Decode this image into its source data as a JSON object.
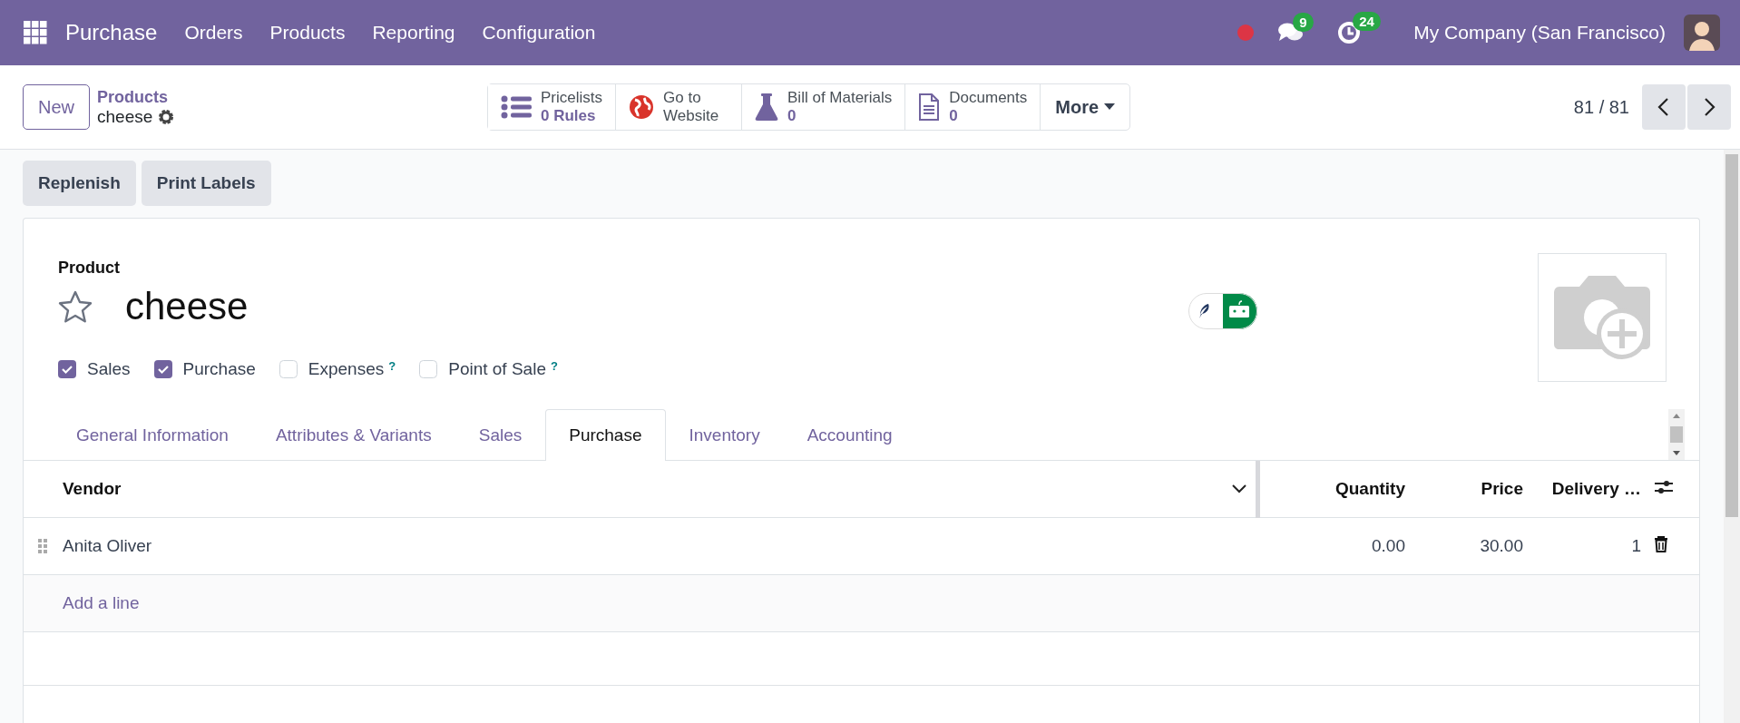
{
  "navbar": {
    "app": "Purchase",
    "menus": [
      "Orders",
      "Products",
      "Reporting",
      "Configuration"
    ],
    "messages_badge": "9",
    "activities_badge": "24",
    "company": "My Company (San Francisco)"
  },
  "control_panel": {
    "new_button": "New",
    "breadcrumb": "Products",
    "record": "cheese",
    "smart_buttons": [
      {
        "kind": "pricelists",
        "label": "Pricelists",
        "value": "0 Rules"
      },
      {
        "kind": "website",
        "label": "Go to Website"
      },
      {
        "kind": "bom",
        "label": "Bill of Materials",
        "value": "0"
      },
      {
        "kind": "documents",
        "label": "Documents",
        "value": "0"
      }
    ],
    "more": "More",
    "pager": "81 / 81"
  },
  "actions": [
    "Replenish",
    "Print Labels"
  ],
  "form": {
    "field_label": "Product",
    "name": "cheese",
    "favorite": false,
    "options": [
      {
        "label": "Sales",
        "checked": true
      },
      {
        "label": "Purchase",
        "checked": true
      },
      {
        "label": "Expenses",
        "checked": false,
        "help": "?"
      },
      {
        "label": "Point of Sale",
        "checked": false,
        "help": "?"
      }
    ],
    "tabs": [
      {
        "label": "General Information",
        "selected": false
      },
      {
        "label": "Attributes & Variants",
        "selected": false
      },
      {
        "label": "Sales",
        "selected": false
      },
      {
        "label": "Purchase",
        "selected": true
      },
      {
        "label": "Inventory",
        "selected": false
      },
      {
        "label": "Accounting",
        "selected": false
      }
    ],
    "table": {
      "columns": [
        "Vendor",
        "Quantity",
        "Price",
        "Delivery …"
      ],
      "rows": [
        {
          "vendor": "Anita Oliver",
          "quantity": "0.00",
          "price": "30.00",
          "delivery": "1"
        }
      ],
      "add_line": "Add a line"
    }
  }
}
